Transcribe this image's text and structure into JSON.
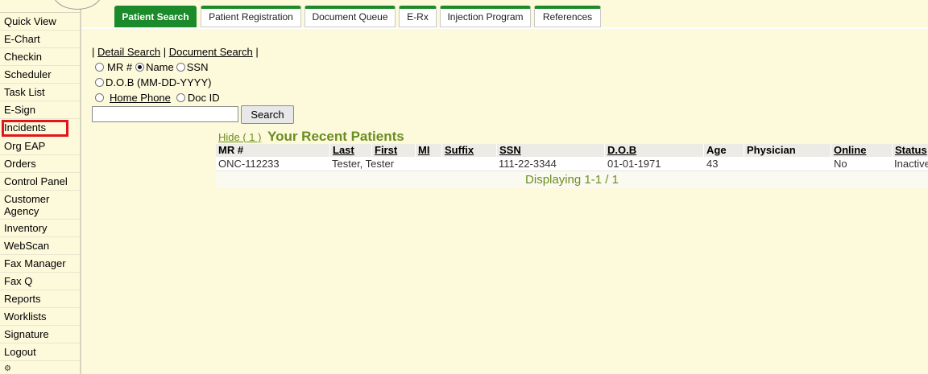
{
  "sidebar": {
    "items": [
      {
        "label": "Quick View"
      },
      {
        "label": "E-Chart"
      },
      {
        "label": "Checkin"
      },
      {
        "label": "Scheduler"
      },
      {
        "label": "Task List"
      },
      {
        "label": "E-Sign"
      },
      {
        "label": "Incidents"
      },
      {
        "label": "Org EAP"
      },
      {
        "label": "Orders"
      },
      {
        "label": "Control Panel"
      },
      {
        "label": "Customer Agency"
      },
      {
        "label": "Inventory"
      },
      {
        "label": "WebScan"
      },
      {
        "label": "Fax Manager"
      },
      {
        "label": "Fax Q"
      },
      {
        "label": "Reports"
      },
      {
        "label": "Worklists"
      },
      {
        "label": "Signature"
      },
      {
        "label": "Logout"
      }
    ],
    "highlight_color": "#e0161a"
  },
  "tabs": [
    {
      "label": "Patient Search",
      "active": true
    },
    {
      "label": "Patient Registration"
    },
    {
      "label": "Document Queue"
    },
    {
      "label": "E-Rx"
    },
    {
      "label": "Injection Program"
    },
    {
      "label": "References"
    }
  ],
  "search": {
    "link_detail": "Detail Search",
    "link_document": "Document Search",
    "sep": "|",
    "radio_mr": "MR #",
    "radio_name": "Name",
    "radio_ssn": "SSN",
    "radio_dob": "D.O.B (MM-DD-YYYY)",
    "radio_phone": "Home Phone",
    "radio_docid": "Doc ID",
    "selected": "Name",
    "input_value": "",
    "button_label": "Search"
  },
  "recent": {
    "hide_label": "Hide ( 1 )",
    "title": "Your Recent Patients",
    "columns": [
      "MR #",
      "Last",
      "First",
      "MI",
      "Suffix",
      "SSN",
      "D.O.B",
      "Age",
      "Physician",
      "Online",
      "Status"
    ],
    "rows": [
      {
        "mr": "ONC-112233",
        "name": "Tester, Tester",
        "ssn": "111-22-3344",
        "dob": "01-01-1971",
        "age": "43",
        "online": "No",
        "status": "Inactive"
      }
    ],
    "footer": "Displaying 1-1 / 1"
  },
  "colors": {
    "background": "#fdf9db",
    "accent_green": "#1b8a2a",
    "title_olive": "#6b8e23"
  }
}
